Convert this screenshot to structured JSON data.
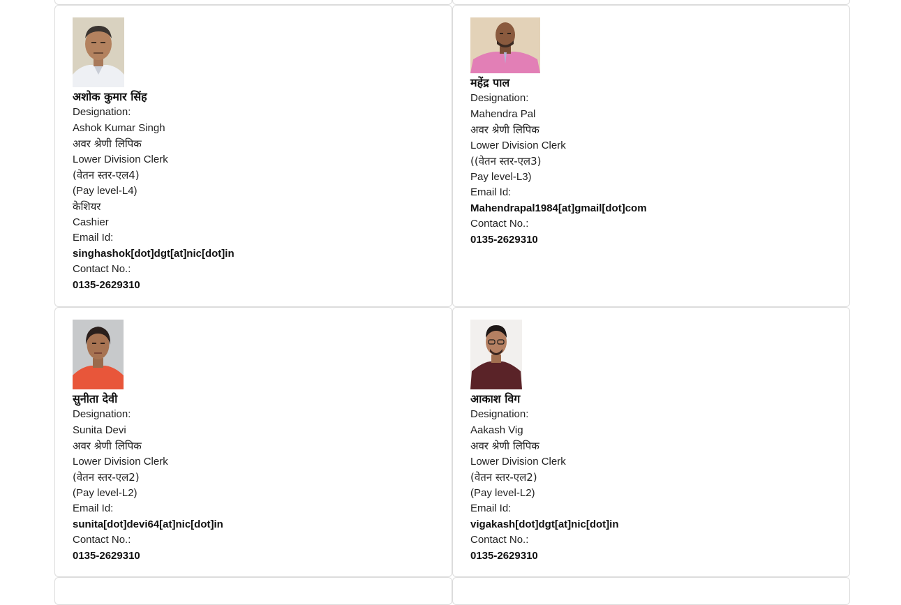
{
  "cards": [
    {
      "name_hi": "अशोक कुमार सिंह",
      "designation_label": "Designation:",
      "name_en": "Ashok Kumar Singh",
      "post_hi": "अवर श्रेणी लिपिक",
      "post_en": "Lower Division Clerk",
      "pay_hi": "(वेतन स्तर-एल4)",
      "pay_en": "(Pay level-L4)",
      "extra_hi": "केशियर",
      "extra_en": "Cashier",
      "email_label": "Email Id:",
      "email": "singhashok[dot]dgt[at]nic[dot]in",
      "contact_label": "Contact No.:",
      "contact": "0135-2629310"
    },
    {
      "name_hi": "महेंद्र पाल",
      "designation_label": "Designation:",
      "name_en": "Mahendra Pal",
      "post_hi": "अवर श्रेणी लिपिक",
      "post_en": "Lower Division Clerk",
      "pay_hi": "((वेतन स्तर-एल3)",
      "pay_en": "Pay level-L3)",
      "email_label": "Email Id:",
      "email": "Mahendrapal1984[at]gmail[dot]com",
      "contact_label": "Contact No.:",
      "contact": "0135-2629310"
    },
    {
      "name_hi": "सुनीता देवी",
      "designation_label": "Designation:",
      "name_en": "Sunita Devi",
      "post_hi": "अवर श्रेणी लिपिक",
      "post_en": "Lower Division Clerk",
      "pay_hi": "(वेतन स्तर-एल2)",
      "pay_en": "(Pay level-L2)",
      "email_label": "Email Id:",
      "email": "sunita[dot]devi64[at]nic[dot]in",
      "contact_label": "Contact No.:",
      "contact": "0135-2629310"
    },
    {
      "name_hi": "आकाश विग",
      "designation_label": "Designation:",
      "name_en": "Aakash Vig",
      "post_hi": "अवर श्रेणी लिपिक",
      "post_en": "Lower Division Clerk",
      "pay_hi": "(वेतन स्तर-एल2)",
      "pay_en": "(Pay level-L2)",
      "email_label": "Email Id:",
      "email": "vigakash[dot]dgt[at]nic[dot]in",
      "contact_label": "Contact No.:",
      "contact": "0135-2629310"
    }
  ]
}
